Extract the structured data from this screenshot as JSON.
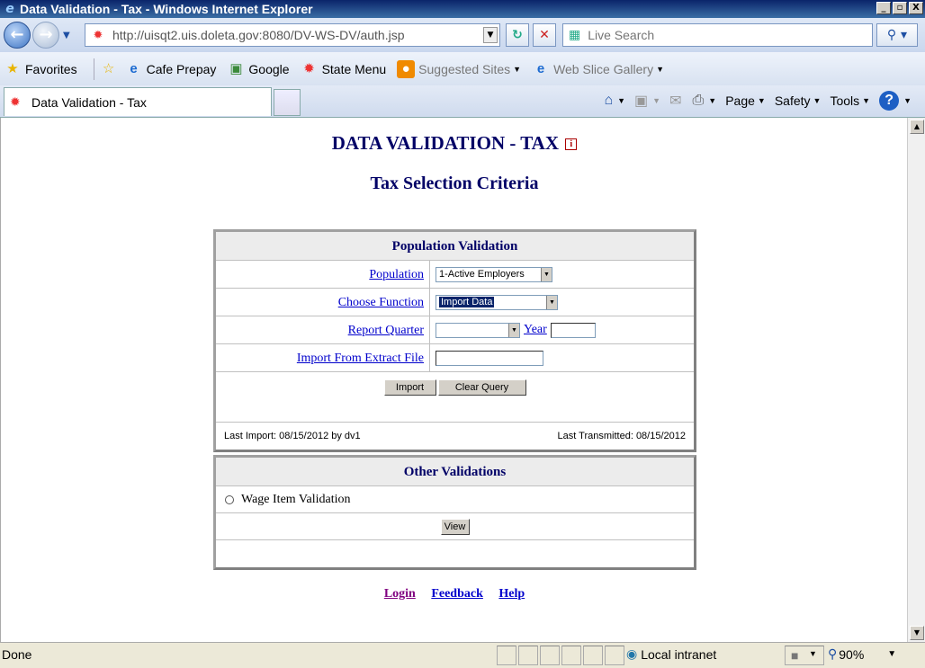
{
  "window": {
    "title": "Data Validation - Tax - Windows Internet Explorer",
    "controls": [
      "_",
      "▫",
      "X"
    ]
  },
  "address_bar": {
    "url": "http://uisqt2.uis.doleta.gov:8080/DV-WS-DV/auth.jsp",
    "search_placeholder": "Live Search"
  },
  "favorites_bar": {
    "favorites_label": "Favorites",
    "items": [
      "Cafe Prepay",
      "Google",
      "State Menu",
      "Suggested Sites",
      "Web Slice Gallery"
    ]
  },
  "tab_bar": {
    "active_tab": "Data Validation - Tax",
    "commands": {
      "page": "Page",
      "safety": "Safety",
      "tools": "Tools"
    }
  },
  "page": {
    "title": "DATA VALIDATION - TAX",
    "subtitle": "Tax Selection Criteria",
    "population_validation": {
      "heading": "Population Validation",
      "population_label": "Population",
      "population_value": "1-Active Employers",
      "function_label": "Choose Function",
      "function_value": "Import Data",
      "quarter_label": "Report Quarter",
      "quarter_value": "",
      "year_label": "Year",
      "year_value": "",
      "import_label": "Import From Extract File",
      "import_value": "",
      "import_button": "Import",
      "clear_button": "Clear Query",
      "last_import": "Last Import: 08/15/2012 by dv1",
      "last_transmitted": "Last Transmitted: 08/15/2012"
    },
    "other_validations": {
      "heading": "Other Validations",
      "option_label": "Wage Item Validation",
      "view_button": "View"
    },
    "bottom_links": {
      "login": "Login",
      "feedback": "Feedback",
      "help": "Help"
    }
  },
  "status_bar": {
    "status": "Done",
    "zone": "Local intranet",
    "zoom": "90%"
  },
  "colors": {
    "heading_text": "#000066",
    "link": "#0000cc",
    "visited_link": "#800080",
    "panel_header_bg": "#ececec"
  }
}
